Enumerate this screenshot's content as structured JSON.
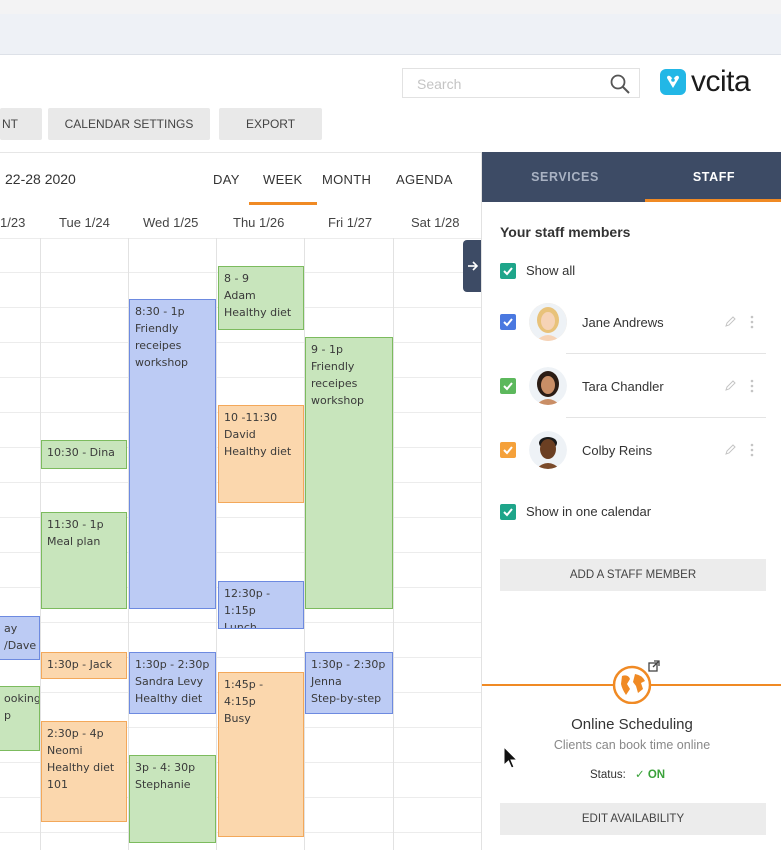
{
  "search": {
    "placeholder": "Search"
  },
  "brand": {
    "name": "vcita"
  },
  "toolbar": {
    "partial_button": "NT",
    "calendar_settings": "CALENDAR SETTINGS",
    "export": "EXPORT"
  },
  "calendar": {
    "date_range": "22-28 2020",
    "views": [
      {
        "label": "DAY",
        "active": false
      },
      {
        "label": "WEEK",
        "active": true
      },
      {
        "label": "MONTH",
        "active": false
      },
      {
        "label": "AGENDA",
        "active": false
      }
    ],
    "days": [
      "1/23",
      "Tue 1/24",
      "Wed 1/25",
      "Thu 1/26",
      "Fri 1/27",
      "Sat 1/28"
    ],
    "events": [
      {
        "day": 0,
        "text": "ay\n/Dave",
        "color": "blue"
      },
      {
        "day": 0,
        "text": "ooking\np",
        "color": "green"
      },
      {
        "day": 1,
        "text": "10:30 - Dina",
        "color": "green"
      },
      {
        "day": 1,
        "text": "11:30 - 1p\nMeal plan",
        "color": "green"
      },
      {
        "day": 1,
        "text": "1:30p - Jack",
        "color": "orange"
      },
      {
        "day": 1,
        "text": "2:30p - 4p\nNeomi\nHealthy diet\n101",
        "color": "orange"
      },
      {
        "day": 2,
        "text": "8:30 - 1p\nFriendly\nreceipes\nworkshop",
        "color": "blue"
      },
      {
        "day": 2,
        "text": "1:30p - 2:30p\nSandra Levy\nHealthy diet",
        "color": "blue"
      },
      {
        "day": 2,
        "text": "3p - 4: 30p\nStephanie",
        "color": "green"
      },
      {
        "day": 3,
        "text": "8 - 9\nAdam\nHealthy diet",
        "color": "green"
      },
      {
        "day": 3,
        "text": "10 -11:30\nDavid\nHealthy diet",
        "color": "orange"
      },
      {
        "day": 3,
        "text": "12:30p - 1:15p\nLunch",
        "color": "blue"
      },
      {
        "day": 3,
        "text": "1:45p - 4:15p\nBusy",
        "color": "orange"
      },
      {
        "day": 4,
        "text": "9 - 1p\nFriendly\nreceipes\nworkshop",
        "color": "green"
      },
      {
        "day": 4,
        "text": "1:30p - 2:30p\nJenna\nStep-by-step",
        "color": "blue"
      }
    ],
    "colors": {
      "green": "#c8e5bc",
      "blue": "#bccbf4",
      "orange": "#fbd7ad"
    }
  },
  "panel": {
    "tabs": [
      {
        "label": "SERVICES",
        "active": false
      },
      {
        "label": "STAFF",
        "active": true
      }
    ],
    "title": "Your staff members",
    "show_all": {
      "label": "Show all",
      "checked": true
    },
    "staff": [
      {
        "name": "Jane Andrews",
        "checked": true,
        "color": "#4a78e0"
      },
      {
        "name": "Tara Chandler",
        "checked": true,
        "color": "#5cb85c"
      },
      {
        "name": "Colby Reins",
        "checked": true,
        "color": "#f5a13a"
      }
    ],
    "show_in_one_calendar": {
      "label": "Show in one calendar",
      "checked": true
    },
    "add_staff_button": "ADD A STAFF MEMBER",
    "scheduling": {
      "title": "Online Scheduling",
      "subtitle": "Clients can book time online",
      "status_label": "Status:",
      "status_value": "✓ ON"
    },
    "edit_availability_button": "EDIT AVAILABILITY"
  },
  "accent_colors": {
    "header": "#3d4b65",
    "highlight": "#f08a24",
    "checkbox_teal": "#1ea58a"
  }
}
